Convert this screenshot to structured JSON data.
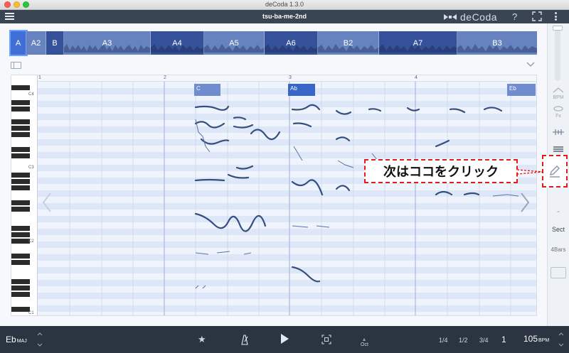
{
  "window": {
    "title": "deCoda 1.3.0"
  },
  "header": {
    "song_title": "tsu-ba-me-2nd",
    "brand": "deCoda",
    "help": "?"
  },
  "sections": [
    {
      "label": "A",
      "active": true
    },
    {
      "label": "A2",
      "active": false
    },
    {
      "label": "B",
      "active": false
    },
    {
      "label": "A3",
      "active": false
    },
    {
      "label": "A4",
      "active": false
    },
    {
      "label": "A5",
      "active": false
    },
    {
      "label": "A6",
      "active": false
    },
    {
      "label": "B2",
      "active": false
    },
    {
      "label": "A7",
      "active": false
    },
    {
      "label": "B3",
      "active": false
    }
  ],
  "piano_roll": {
    "octave_labels": [
      "C4",
      "C3",
      "C2",
      "C1"
    ],
    "bar_numbers": [
      "1",
      "2",
      "3",
      "4"
    ],
    "chords": [
      "C",
      "Ab",
      "Eb"
    ]
  },
  "right_panel": {
    "bpm_label": "BPM",
    "fx_label": "Fx",
    "sect_label": "Sect",
    "bars_label": "4Bars"
  },
  "callout": {
    "text": "次はココをクリック"
  },
  "bottom": {
    "key": "Eb",
    "mode": "MAJ",
    "oct_label": "Oct",
    "quant": [
      "1/4",
      "1/2",
      "3/4"
    ],
    "bar_counter": "1",
    "bpm": "105",
    "bpm_unit": "BPM"
  },
  "colors": {
    "section_strip": "#5672b0",
    "active_section": "#3f6fd6",
    "callout_border": "#e21c1c",
    "bottom_bar": "#2b3441",
    "header": "#3a4553"
  }
}
